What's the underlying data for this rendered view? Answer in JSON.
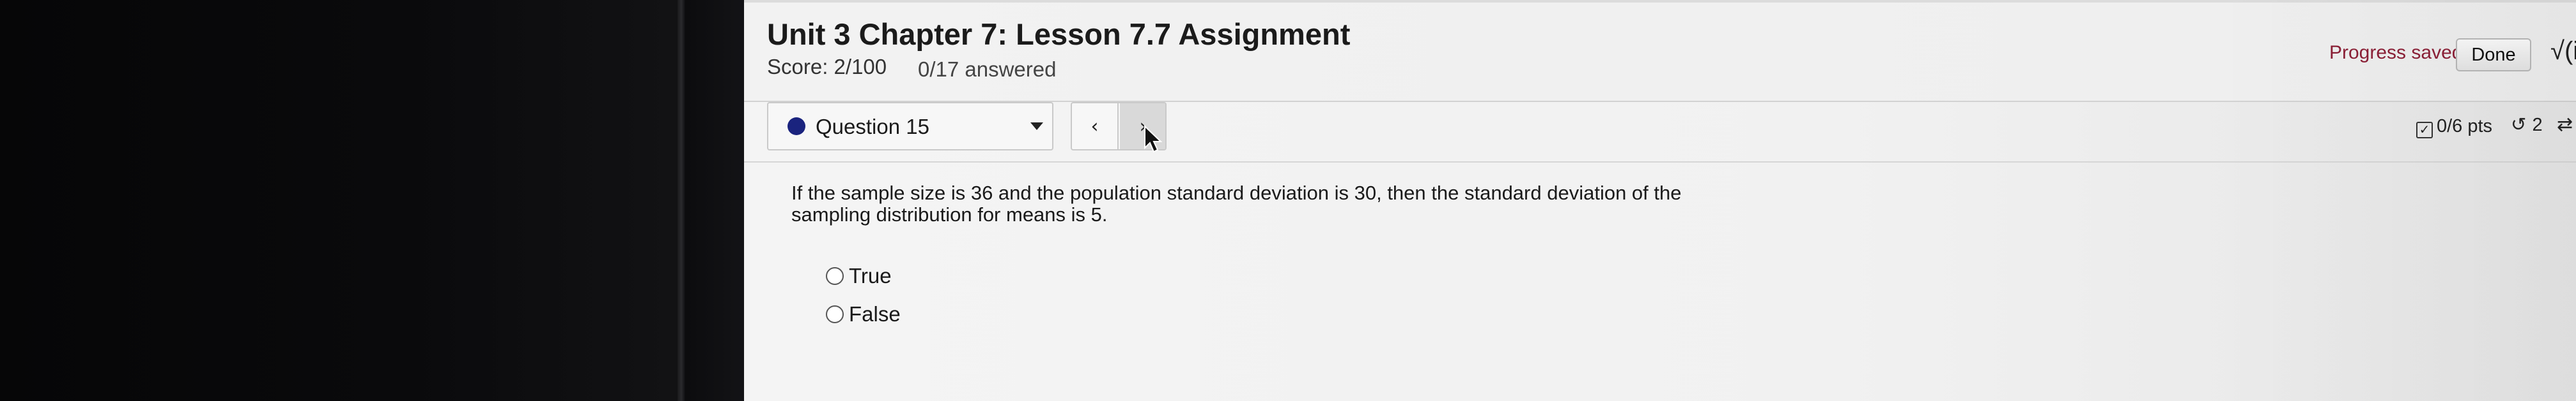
{
  "header": {
    "title": "Unit 3 Chapter 7: Lesson 7.7 Assignment",
    "score": "Score: 2/100",
    "answered": "0/17 answered",
    "progress_status": "Progress saved",
    "done_label": "Done",
    "math_tool_label": "√(i"
  },
  "question_nav": {
    "selected_question": "Question 15",
    "prev_glyph": "‹",
    "next_glyph": "›"
  },
  "status": {
    "points": "0/6 pts",
    "retries": "2"
  },
  "question": {
    "text": "If the sample size is 36 and the population standard deviation is 30, then the standard deviation of the sampling distribution for means is 5.",
    "options": [
      "True",
      "False"
    ]
  },
  "colors": {
    "accent_dot": "#1a237e",
    "progress_saved": "#8b1f36"
  }
}
